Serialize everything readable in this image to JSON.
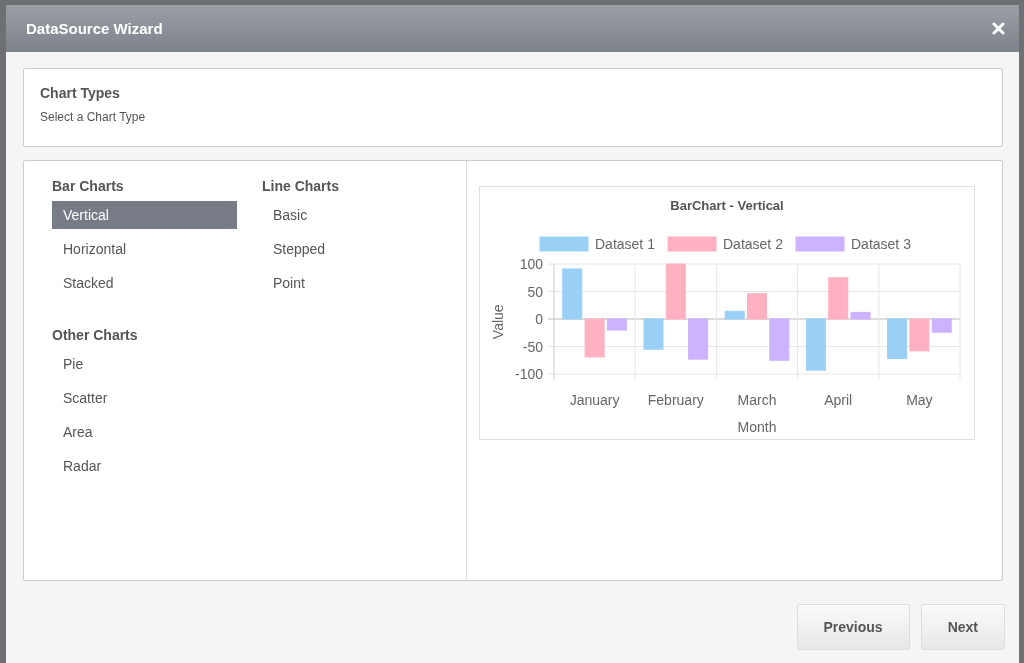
{
  "window": {
    "title": "DataSource Wizard"
  },
  "intro": {
    "title": "Chart Types",
    "subtitle": "Select a Chart Type"
  },
  "groups": [
    {
      "title": "Bar Charts",
      "items": [
        {
          "label": "Vertical",
          "selected": true
        },
        {
          "label": "Horizontal",
          "selected": false
        },
        {
          "label": "Stacked",
          "selected": false
        }
      ]
    },
    {
      "title": "Line Charts",
      "items": [
        {
          "label": "Basic",
          "selected": false
        },
        {
          "label": "Stepped",
          "selected": false
        },
        {
          "label": "Point",
          "selected": false
        }
      ]
    },
    {
      "title": "Other Charts",
      "items": [
        {
          "label": "Pie",
          "selected": false
        },
        {
          "label": "Scatter",
          "selected": false
        },
        {
          "label": "Area",
          "selected": false
        },
        {
          "label": "Radar",
          "selected": false
        }
      ]
    }
  ],
  "preview": {
    "chart_data": {
      "type": "bar",
      "title": "BarChart - Vertical",
      "xlabel": "Month",
      "ylabel": "Value",
      "categories": [
        "January",
        "February",
        "March",
        "April",
        "May"
      ],
      "series": [
        {
          "name": "Dataset 1",
          "color": "#9ad0f5",
          "values": [
            91,
            -55,
            14,
            -93,
            -72
          ]
        },
        {
          "name": "Dataset 2",
          "color": "#ffb1c1",
          "values": [
            -69,
            100,
            46,
            75,
            -58
          ]
        },
        {
          "name": "Dataset 3",
          "color": "#ccb2ff",
          "values": [
            -20,
            -73,
            -75,
            12,
            -24
          ]
        }
      ],
      "ylim": [
        -110,
        100
      ],
      "yticks": [
        100,
        50,
        0,
        -50,
        -100
      ],
      "grid": true,
      "legend": true
    }
  },
  "buttons": [
    "Previous",
    "Next"
  ]
}
